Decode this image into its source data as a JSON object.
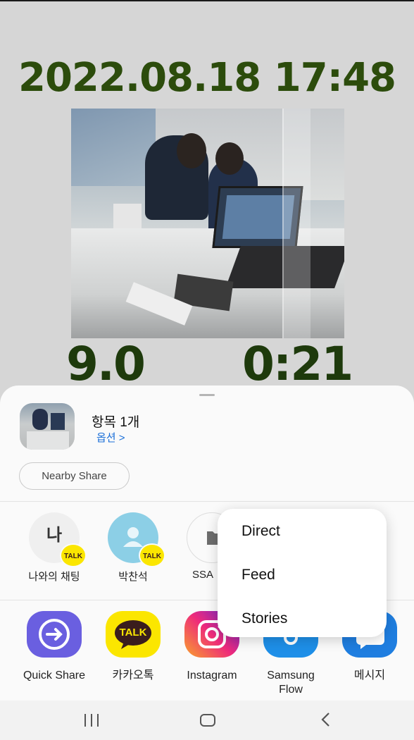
{
  "overlay": {
    "datetime": "2022.08.18 17:48",
    "value_left": "9.0",
    "value_right": "0:21"
  },
  "share_sheet": {
    "item_count": "항목 1개",
    "options_link": "옵션 >",
    "nearby_share": "Nearby Share",
    "contacts": [
      {
        "label": "나와의 채팅",
        "avatar_text": "나",
        "badge": "TALK"
      },
      {
        "label": "박찬석",
        "avatar_text": "",
        "badge": "TALK"
      },
      {
        "label": "SSA",
        "avatar_text": ""
      }
    ],
    "apps": [
      {
        "label": "Quick Share",
        "icon": "quick-share-icon"
      },
      {
        "label": "카카오톡",
        "icon": "kakaotalk-icon",
        "icon_text": "TALK"
      },
      {
        "label": "Instagram",
        "icon": "instagram-icon"
      },
      {
        "label": "Samsung\nFlow",
        "icon": "samsung-flow-icon"
      },
      {
        "label": "메시지",
        "icon": "messages-icon"
      }
    ]
  },
  "popup_menu": {
    "items": [
      "Direct",
      "Feed",
      "Stories"
    ]
  },
  "navbar": {
    "recent": "recent-apps-icon",
    "home": "home-icon",
    "back": "back-icon"
  },
  "colors": {
    "overlay_text": "#2c4c0c",
    "link": "#1b6fd8",
    "kakao_yellow": "#fbe600"
  }
}
